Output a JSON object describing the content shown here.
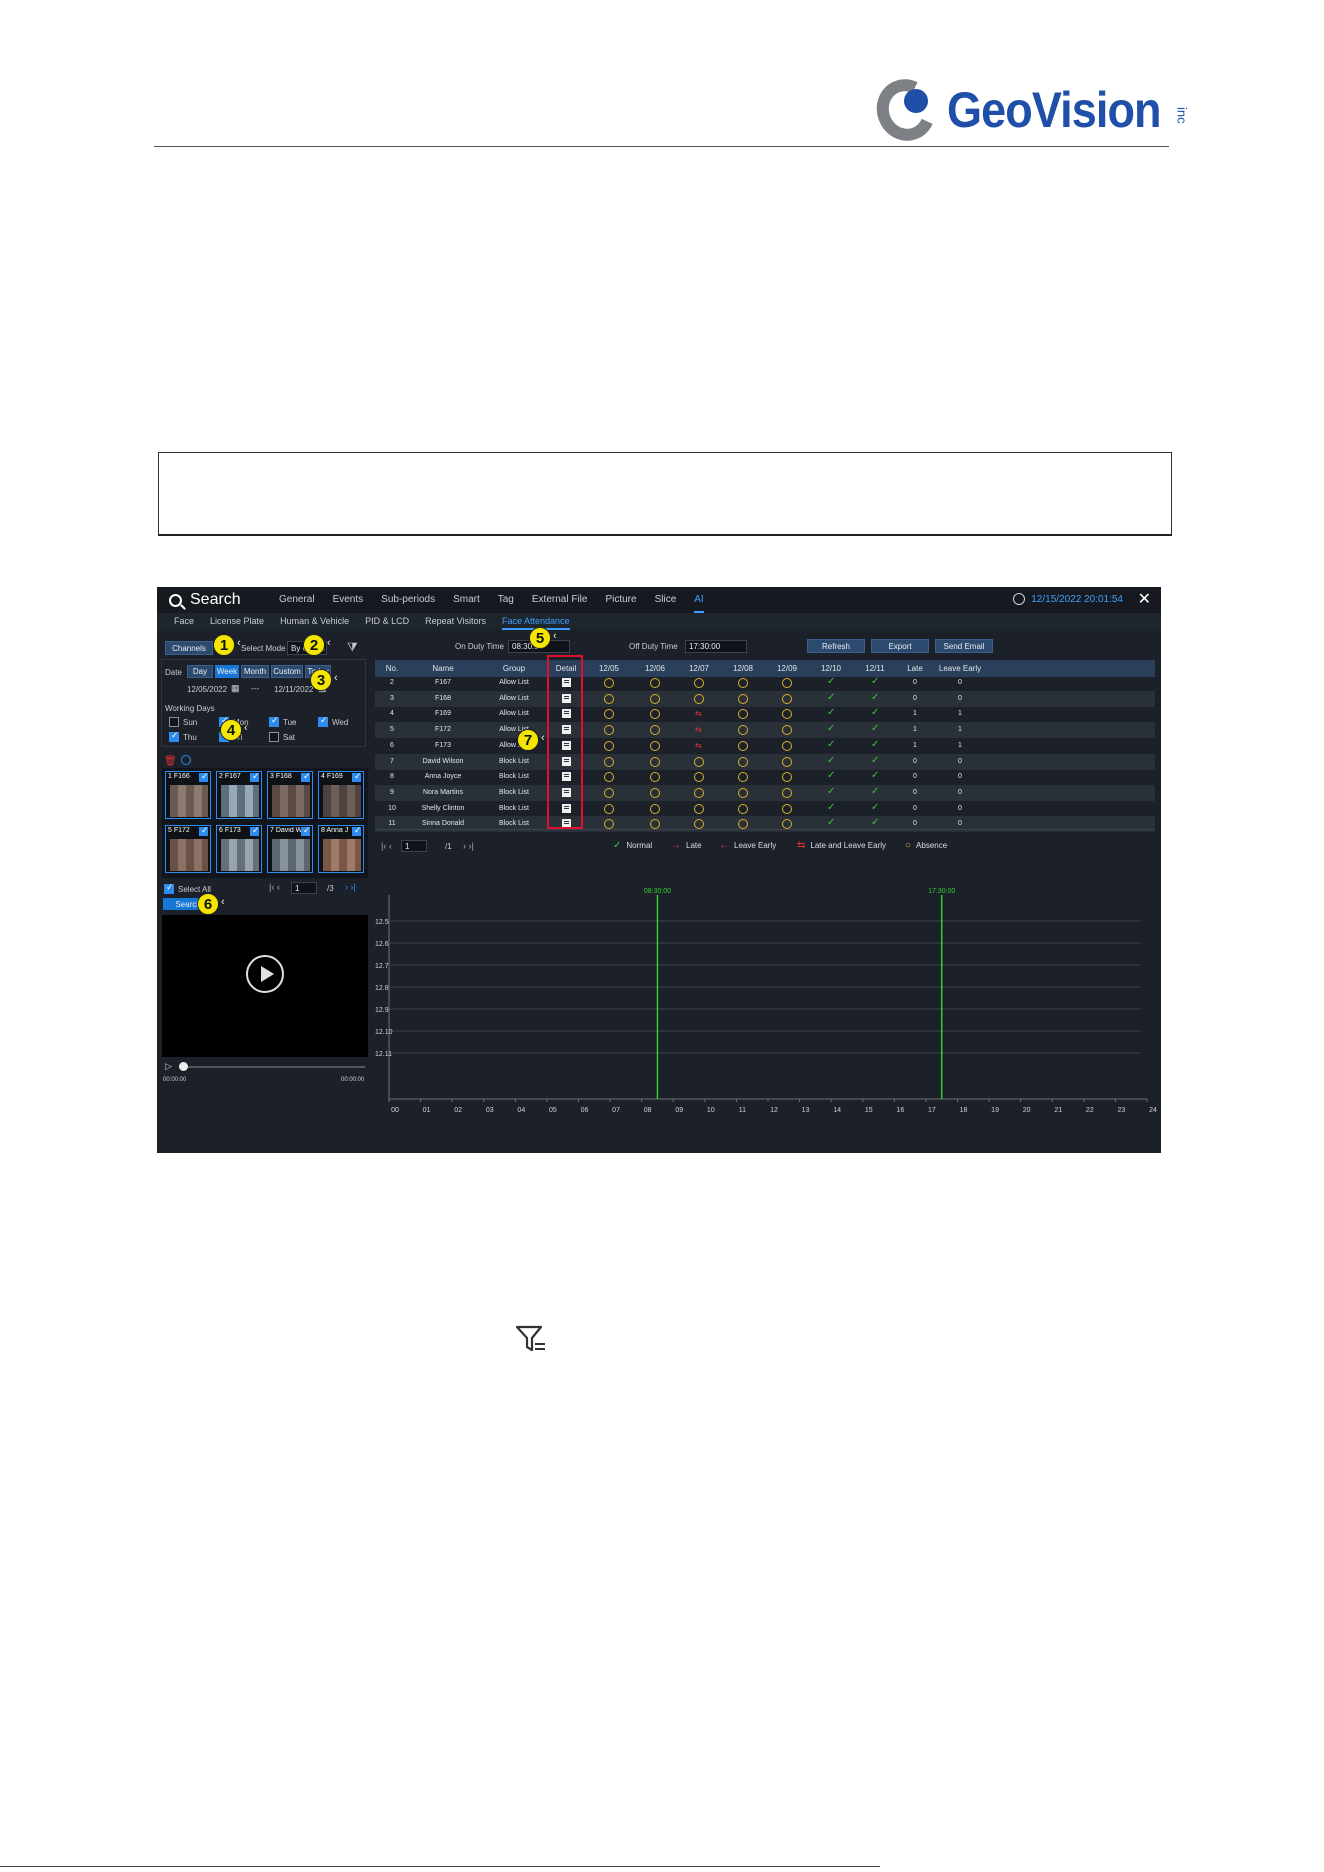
{
  "brand": {
    "name": "GeoVision",
    "suffix": "inc"
  },
  "app": {
    "title": "Search",
    "nav": [
      "General",
      "Events",
      "Sub-periods",
      "Smart",
      "Tag",
      "External File",
      "Picture",
      "Slice",
      "AI"
    ],
    "nav_active": "AI",
    "datetime": "12/15/2022 20:01:54",
    "close": "✕",
    "subtabs": [
      "Face",
      "License Plate",
      "Human & Vehicle",
      "PID & LCD",
      "Repeat Visitors",
      "Face Attendance"
    ],
    "subtab_active": "Face Attendance"
  },
  "left": {
    "channels_btn": "Channels",
    "select_mode_label": "Select Mode",
    "select_mode_value": "By Group",
    "date_label": "Date",
    "date_tabs": [
      "Day",
      "Week",
      "Month",
      "Custom",
      "Today"
    ],
    "date_active": "Week",
    "date_from": "12/05/2022",
    "date_sep": "---",
    "date_to": "12/11/2022",
    "working_days_label": "Working Days",
    "days": [
      {
        "label": "Sun",
        "checked": false
      },
      {
        "label": "Mon",
        "checked": true
      },
      {
        "label": "Tue",
        "checked": true
      },
      {
        "label": "Wed",
        "checked": true
      },
      {
        "label": "Thu",
        "checked": true
      },
      {
        "label": "Fri",
        "checked": true
      },
      {
        "label": "Sat",
        "checked": false
      }
    ],
    "thumbs": [
      "1 F166",
      "2 F167",
      "3 F168",
      "4 F169",
      "5 F172",
      "6 F173",
      "7 David W",
      "8 Anna J"
    ],
    "select_all": "Select All",
    "page_current": "1",
    "page_total": "/3",
    "search_btn": "Search",
    "time_start": "00:00:00",
    "time_end": "00:00:00"
  },
  "right": {
    "on_duty_label": "On Duty Time",
    "on_duty_value": "08:30:00",
    "off_duty_label": "Off Duty Time",
    "off_duty_value": "17:30:00",
    "refresh_btn": "Refresh",
    "export_btn": "Export",
    "send_email_btn": "Send Email",
    "columns": [
      "No.",
      "Name",
      "Group",
      "Detail",
      "12/05",
      "12/06",
      "12/07",
      "12/08",
      "12/09",
      "12/10",
      "12/11",
      "Late",
      "Leave Early"
    ],
    "rows": [
      {
        "no": "2",
        "name": "F167",
        "group": "Allow List",
        "marks": [
          "A",
          "A",
          "A",
          "A",
          "A",
          "N",
          "N"
        ],
        "late": "0",
        "early": "0"
      },
      {
        "no": "3",
        "name": "F168",
        "group": "Allow List",
        "marks": [
          "A",
          "A",
          "A",
          "A",
          "A",
          "N",
          "N"
        ],
        "late": "0",
        "early": "0"
      },
      {
        "no": "4",
        "name": "F169",
        "group": "Allow List",
        "marks": [
          "A",
          "A",
          "LE",
          "A",
          "A",
          "N",
          "N"
        ],
        "late": "1",
        "early": "1"
      },
      {
        "no": "5",
        "name": "F172",
        "group": "Allow List",
        "marks": [
          "A",
          "A",
          "LE",
          "A",
          "A",
          "N",
          "N"
        ],
        "late": "1",
        "early": "1"
      },
      {
        "no": "6",
        "name": "F173",
        "group": "Allow List",
        "marks": [
          "A",
          "A",
          "LE",
          "A",
          "A",
          "N",
          "N"
        ],
        "late": "1",
        "early": "1"
      },
      {
        "no": "7",
        "name": "David Wilson",
        "group": "Block List",
        "marks": [
          "A",
          "A",
          "A",
          "A",
          "A",
          "N",
          "N"
        ],
        "late": "0",
        "early": "0"
      },
      {
        "no": "8",
        "name": "Anna Joyce",
        "group": "Block List",
        "marks": [
          "A",
          "A",
          "A",
          "A",
          "A",
          "N",
          "N"
        ],
        "late": "0",
        "early": "0"
      },
      {
        "no": "9",
        "name": "Nora Martins",
        "group": "Block List",
        "marks": [
          "A",
          "A",
          "A",
          "A",
          "A",
          "N",
          "N"
        ],
        "late": "0",
        "early": "0"
      },
      {
        "no": "10",
        "name": "Shelly Clinton",
        "group": "Block List",
        "marks": [
          "A",
          "A",
          "A",
          "A",
          "A",
          "N",
          "N"
        ],
        "late": "0",
        "early": "0"
      },
      {
        "no": "11",
        "name": "Sinna Donald",
        "group": "Block List",
        "marks": [
          "A",
          "A",
          "A",
          "A",
          "A",
          "N",
          "N"
        ],
        "late": "0",
        "early": "0"
      }
    ],
    "table_page_current": "1",
    "table_page_total": "/1",
    "legend": [
      "Normal",
      "Late",
      "Leave Early",
      "Late and Leave Early",
      "Absence"
    ],
    "callouts": [
      "1",
      "2",
      "3",
      "4",
      "5",
      "6",
      "7"
    ]
  },
  "colors": {
    "accent": "#2d8cf0",
    "normal": "#38c738",
    "late": "#e03030",
    "absence": "#d8b02a",
    "duty_line": "#2fd12f",
    "frame": "#e0102c",
    "brand": "#1f4fa8"
  },
  "chart_data": {
    "type": "timeline",
    "y_categories": [
      "12.5",
      "12.6",
      "12.7",
      "12.8",
      "12.9",
      "12.10",
      "12.11"
    ],
    "x_ticks": [
      "00",
      "01",
      "02",
      "03",
      "04",
      "05",
      "06",
      "07",
      "08",
      "09",
      "10",
      "11",
      "12",
      "13",
      "14",
      "15",
      "16",
      "17",
      "18",
      "19",
      "20",
      "21",
      "22",
      "23",
      "24"
    ],
    "xlim": [
      0,
      24
    ],
    "markers": [
      {
        "label": "08:30:00",
        "x": 8.5
      },
      {
        "label": "17:30:00",
        "x": 17.5
      }
    ],
    "grid": true
  }
}
